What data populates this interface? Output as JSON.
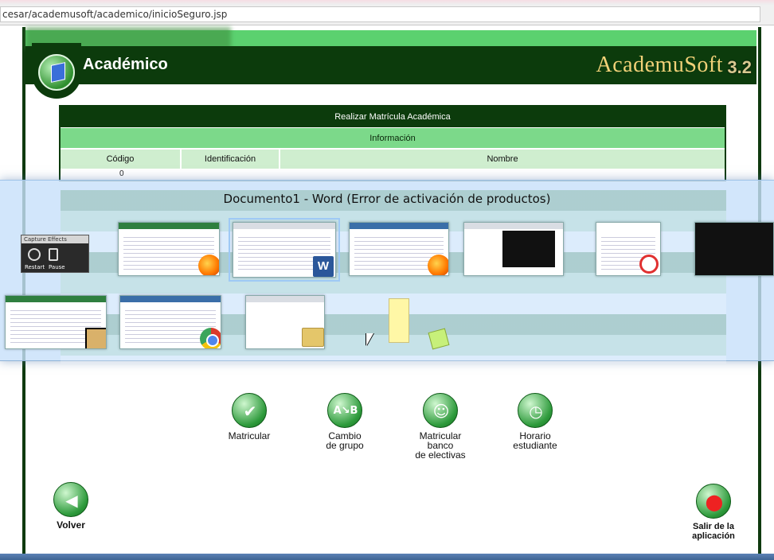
{
  "browser": {
    "url": "cesar/academusoft/academico/inicioSeguro.jsp"
  },
  "header": {
    "module_title": "Académico",
    "brand": "AcademuSoft",
    "version": "3.2"
  },
  "matricula_table": {
    "title": "Realizar Matrícula Académica",
    "section": "Información",
    "columns": [
      "Código",
      "Identificación",
      "Nombre"
    ],
    "first_cell": "0"
  },
  "actions": [
    {
      "label": "Matricular",
      "icon": "check-icon"
    },
    {
      "label": "Cambio\nde grupo",
      "icon": "ab-swap-icon"
    },
    {
      "label": "Matricular\nbanco\nde electivas",
      "icon": "group-check-icon"
    },
    {
      "label": "Horario\nestudiante",
      "icon": "clock-icon"
    }
  ],
  "footer": {
    "back_label": "Volver",
    "exit_label": "Salir de la\naplicación"
  },
  "task_switcher": {
    "active_window_title": "Documento1 - Word (Error de activación de productos)",
    "capture_widget": {
      "tabs": "Capture   Effects",
      "restart": "Restart",
      "pause": "Pause"
    }
  },
  "colors": {
    "dark_green": "#0c3b0c",
    "light_green": "#7cd98a",
    "accent_green": "#5bd16f",
    "brand_gold": "#f1d178"
  }
}
